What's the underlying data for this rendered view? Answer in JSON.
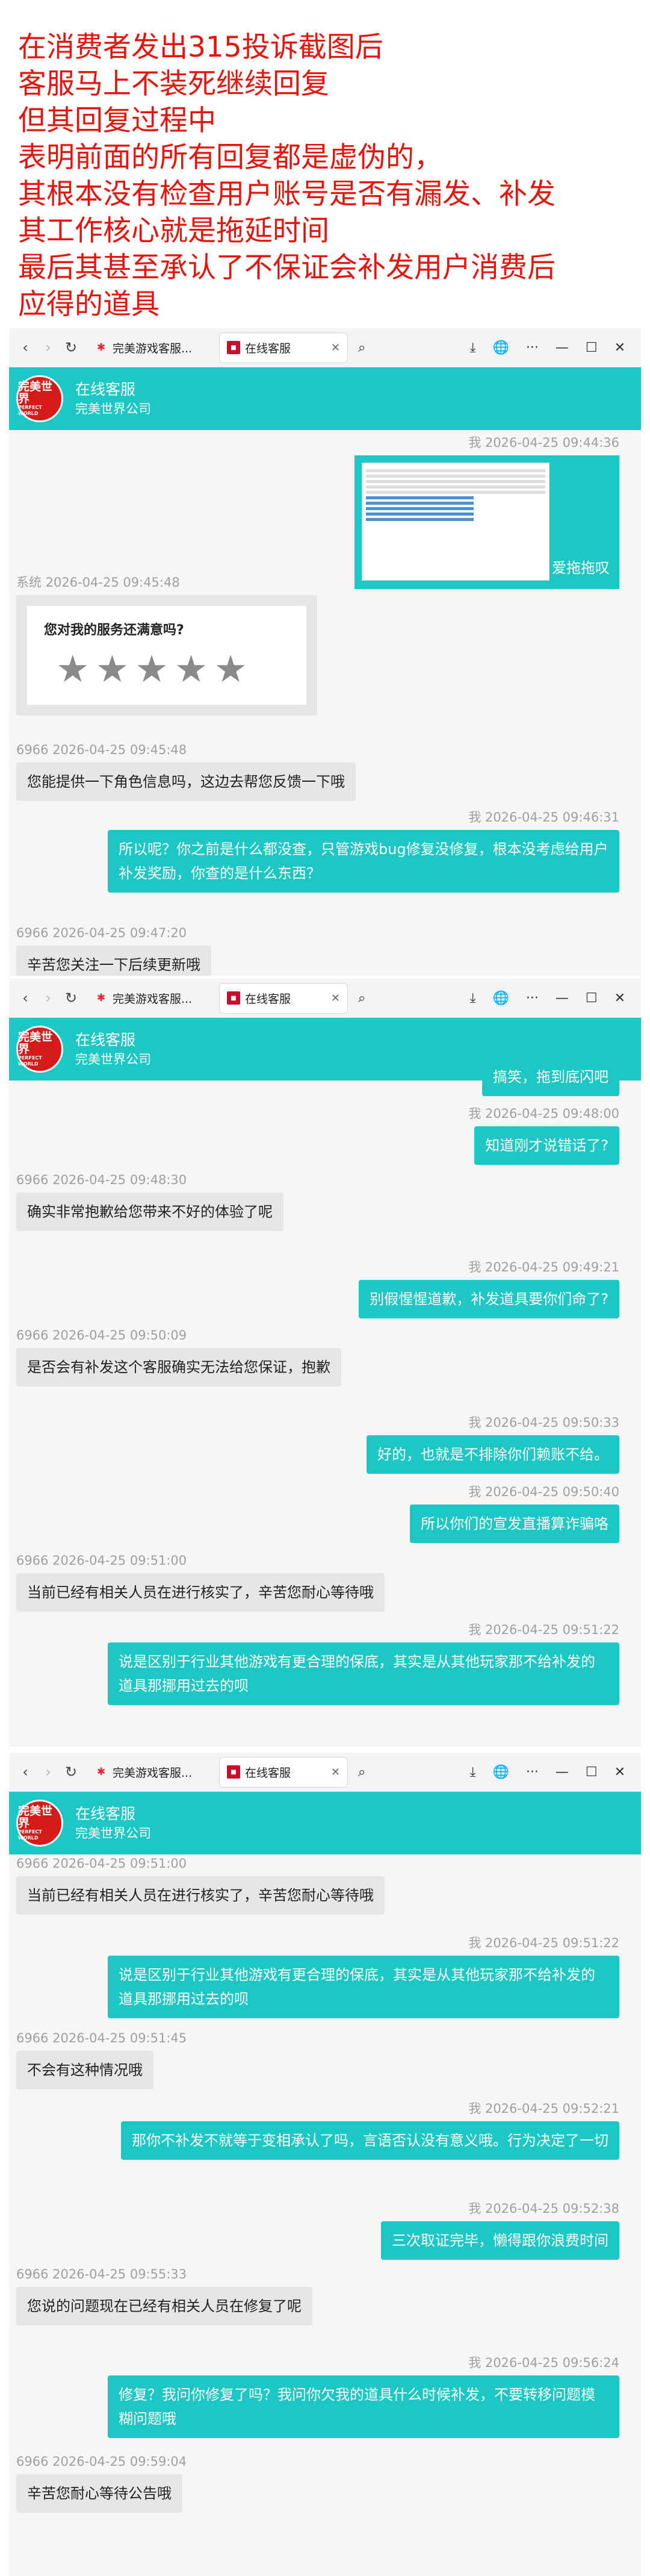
{
  "caption": [
    "在消费者发出315投诉截图后",
    "客服马上不装死继续回复",
    "但其回复过程中",
    "表明前面的所有回复都是虚伪的，",
    "其根本没有检查用户账号是否有漏发、补发",
    "其工作核心就是拖延时间",
    "最后其甚至承认了不保证会补发用户消费后",
    "应得的道具"
  ],
  "browser": {
    "tab1": "完美游戏客服...",
    "tab2": "在线客服",
    "tab_close": "✕",
    "nav_back": "‹",
    "nav_fwd": "›",
    "reload": "↻",
    "search": "⌕",
    "download": "⤓",
    "globe": "🌐",
    "more": "···",
    "min": "—",
    "max": "☐",
    "close": "✕"
  },
  "header": {
    "title": "在线客服",
    "subtitle": "完美世界公司",
    "logo_text": "完美世界",
    "logo_sub": "PERFECT WORLD"
  },
  "rating": {
    "question": "您对我的服务还满意吗?",
    "stars": "★"
  },
  "screen1": [
    {
      "side": "right",
      "meta": "我  2026-04-25 09:44:36",
      "image": true,
      "text": "爱拖拖叹"
    },
    {
      "side": "left",
      "meta": "系统  2026-04-25 09:45:48",
      "rating": true
    },
    {
      "side": "left",
      "meta": "6966  2026-04-25 09:45:48",
      "text": "您能提供一下角色信息吗，这边去帮您反馈一下哦"
    },
    {
      "side": "right",
      "meta": "我  2026-04-25 09:46:31",
      "text": "所以呢？你之前是什么都没查，只管游戏bug修复没修复，根本没考虑给用户补发奖励，你查的是什么东西？"
    },
    {
      "side": "left",
      "meta": "6966  2026-04-25 09:47:20",
      "text": "辛苦您关注一下后续更新哦"
    }
  ],
  "screen2": [
    {
      "side": "right",
      "partial": true,
      "text": "搞笑，拖到底闪吧"
    },
    {
      "side": "right",
      "meta": "我  2026-04-25 09:48:00",
      "text": "知道刚才说错话了?"
    },
    {
      "side": "left",
      "meta": "6966  2026-04-25 09:48:30",
      "text": "确实非常抱歉给您带来不好的体验了呢"
    },
    {
      "side": "right",
      "meta": "我  2026-04-25 09:49:21",
      "text": "别假惺惺道歉，补发道具要你们命了?"
    },
    {
      "side": "left",
      "meta": "6966  2026-04-25 09:50:09",
      "text": "是否会有补发这个客服确实无法给您保证，抱歉"
    },
    {
      "side": "right",
      "meta": "我  2026-04-25 09:50:33",
      "text": "好的，也就是不排除你们赖账不给。"
    },
    {
      "side": "right",
      "meta": "我  2026-04-25 09:50:40",
      "text": "所以你们的宣发直播算诈骗咯"
    },
    {
      "side": "left",
      "meta": "6966  2026-04-25 09:51:00",
      "text": "当前已经有相关人员在进行核实了，辛苦您耐心等待哦"
    },
    {
      "side": "right",
      "meta": "我  2026-04-25 09:51:22",
      "text": "说是区别于行业其他游戏有更合理的保底，其实是从其他玩家那不给补发的道具那挪用过去的呗"
    }
  ],
  "screen3": [
    {
      "side": "left",
      "meta": "6966  2026-04-25 09:51:00",
      "text": "当前已经有相关人员在进行核实了，辛苦您耐心等待哦"
    },
    {
      "side": "right",
      "meta": "我  2026-04-25 09:51:22",
      "text": "说是区别于行业其他游戏有更合理的保底，其实是从其他玩家那不给补发的道具那挪用过去的呗"
    },
    {
      "side": "left",
      "meta": "6966  2026-04-25 09:51:45",
      "text": "不会有这种情况哦"
    },
    {
      "side": "right",
      "meta": "我  2026-04-25 09:52:21",
      "text": "那你不补发不就等于变相承认了吗，言语否认没有意义哦。行为决定了一切"
    },
    {
      "side": "right",
      "meta": "我  2026-04-25 09:52:38",
      "text": "三次取证完毕，懒得跟你浪费时间"
    },
    {
      "side": "left",
      "meta": "6966  2026-04-25 09:55:33",
      "text": "您说的问题现在已经有相关人员在修复了呢"
    },
    {
      "side": "right",
      "meta": "我  2026-04-25 09:56:24",
      "text": "修复？我问你修复了吗？我问你欠我的道具什么时候补发，不要转移问题模糊问题哦"
    },
    {
      "side": "left",
      "meta": "6966  2026-04-25 09:59:04",
      "text": "辛苦您耐心等待公告哦"
    }
  ]
}
